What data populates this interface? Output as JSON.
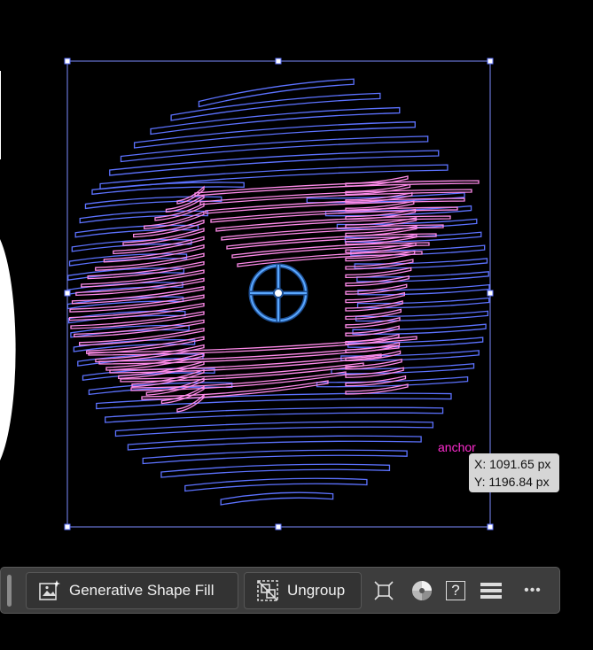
{
  "coordinates": {
    "x": "X: 1091.65 px",
    "y": "Y: 1196.84 px"
  },
  "anchor_label": "anchor",
  "toolbar": {
    "generative_shape_fill": "Generative Shape Fill",
    "ungroup": "Ungroup",
    "help": "?",
    "more": "•••"
  },
  "icons": [
    "generative-shape-fill-icon",
    "ungroup-icon",
    "transform-icon",
    "color-wheel-icon",
    "help-icon",
    "menu-icon",
    "more-icon"
  ],
  "colors": {
    "blue_strokes": "#5c72ff",
    "pink_strokes": "#ff8bea",
    "selection": "#7d8cff",
    "crosshair": "#5aa8ff",
    "anchor": "#ff2bd0"
  }
}
